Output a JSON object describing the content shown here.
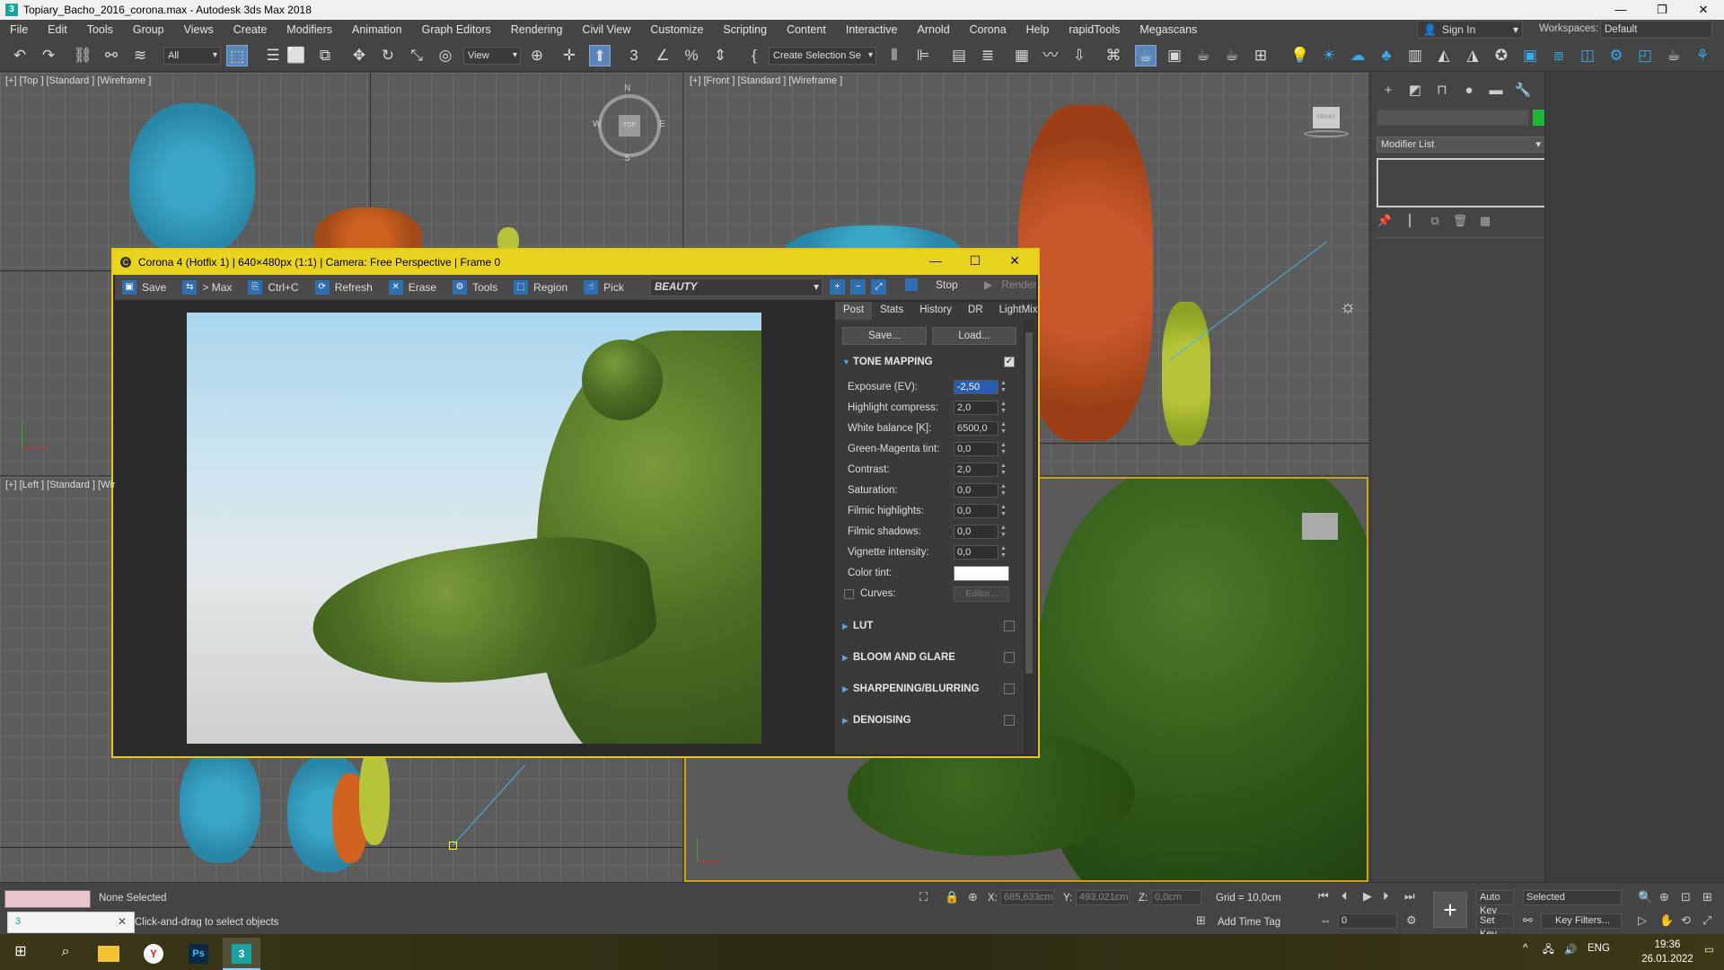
{
  "window": {
    "title": "Topiary_Bacho_2016_corona.max - Autodesk 3ds Max 2018",
    "controls": [
      "—",
      "❐",
      "✕"
    ]
  },
  "menu": {
    "items": [
      "File",
      "Edit",
      "Tools",
      "Group",
      "Views",
      "Create",
      "Modifiers",
      "Animation",
      "Graph Editors",
      "Rendering",
      "Civil View",
      "Customize",
      "Scripting",
      "Content",
      "Interactive",
      "Arnold",
      "Corona",
      "Help",
      "rapidTools",
      "Megascans"
    ],
    "sign_in": "Sign In",
    "workspaces_label": "Workspaces:",
    "workspace": "Default"
  },
  "toolbar": {
    "filter": "All",
    "coord_system": "View",
    "selection_set": "Create Selection Se"
  },
  "viewports": {
    "top": "[+] [Top ] [Standard ] [Wireframe ]",
    "front": "[+] [Front ] [Standard ] [Wireframe ]",
    "left": "[+] [Left ] [Standard ] [Wir",
    "compass": {
      "n": "N",
      "s": "S",
      "w": "W",
      "e": "E",
      "center": "TOP"
    },
    "viewcube_front": "FRONT"
  },
  "command_panel": {
    "modifier_list": "Modifier List"
  },
  "corona": {
    "title": "Corona 4 (Hotfix 1) | 640×480px (1:1) | Camera: Free Perspective | Frame 0",
    "buttons": {
      "save": "Save",
      "to_max": "> Max",
      "copy": "Ctrl+C",
      "refresh": "Refresh",
      "erase": "Erase",
      "tools": "Tools",
      "region": "Region",
      "pick": "Pick",
      "stop": "Stop",
      "render": "Render"
    },
    "channel": "BEAUTY",
    "tabs": [
      "Post",
      "Stats",
      "History",
      "DR",
      "LightMix"
    ],
    "save_btn": "Save...",
    "load_btn": "Load...",
    "sections": {
      "tone_mapping": "TONE MAPPING",
      "lut": "LUT",
      "bloom": "BLOOM AND GLARE",
      "sharpen": "SHARPENING/BLURRING",
      "denoise": "DENOISING"
    },
    "params": [
      {
        "name": "Exposure (EV):",
        "value": "-2,50"
      },
      {
        "name": "Highlight compress:",
        "value": "2,0"
      },
      {
        "name": "White balance [K]:",
        "value": "6500,0"
      },
      {
        "name": "Green-Magenta tint:",
        "value": "0,0"
      },
      {
        "name": "Contrast:",
        "value": "2,0"
      },
      {
        "name": "Saturation:",
        "value": "0,0"
      },
      {
        "name": "Filmic highlights:",
        "value": "0,0"
      },
      {
        "name": "Filmic shadows:",
        "value": "0,0"
      },
      {
        "name": "Vignette intensity:",
        "value": "0,0"
      }
    ],
    "color_tint_label": "Color tint:",
    "curves_label": "Curves:",
    "editor_btn": "Editor..."
  },
  "status": {
    "selection": "None Selected",
    "prompt": "Click-and-drag to select objects",
    "x_label": "X:",
    "x_value": "685,633cm",
    "y_label": "Y:",
    "y_value": "493,021cm",
    "z_label": "Z:",
    "z_value": "0,0cm",
    "grid": "Grid = 10,0cm",
    "add_time_tag": "Add Time Tag",
    "auto_key": "Auto Key",
    "set_key": "Set Key",
    "selected": "Selected",
    "key_filters": "Key Filters...",
    "frame": "0"
  },
  "taskbar": {
    "lang": "ENG",
    "time": "19:36",
    "date": "26.01.2022"
  }
}
